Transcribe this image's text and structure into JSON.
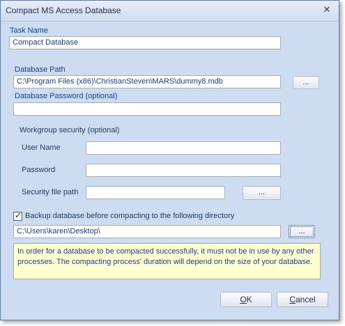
{
  "window": {
    "title": "Compact MS Access Database",
    "close_label": "✕"
  },
  "task": {
    "label": "Task Name",
    "value": "Compact Database"
  },
  "database": {
    "path_label": "Database Path",
    "path_value": "C:\\Program Files (x86)\\ChristianSteven\\MARS\\dummy8.mdb",
    "browse_label": "...",
    "password_label": "Database Password (optional)",
    "password_value": ""
  },
  "workgroup": {
    "section_label": "Workgroup security (optional)",
    "username_label": "User Name",
    "username_value": "",
    "password_label": "Password",
    "password_value": "",
    "security_file_label": "Security file path",
    "security_file_value": "",
    "browse_label": "..."
  },
  "backup": {
    "checkbox_label": "Backup database before compacting to the following directory",
    "checked": true,
    "directory_value": "C:\\Users\\karen\\Desktop\\",
    "browse_label": "..."
  },
  "note": {
    "text": "In order for a database to be compacted successfully, it must not be in use by any other processes. The compacting process' duration will depend on the size of your database."
  },
  "buttons": {
    "ok_accel": "O",
    "ok_rest": "K",
    "cancel_accel": "C",
    "cancel_rest": "ancel"
  }
}
